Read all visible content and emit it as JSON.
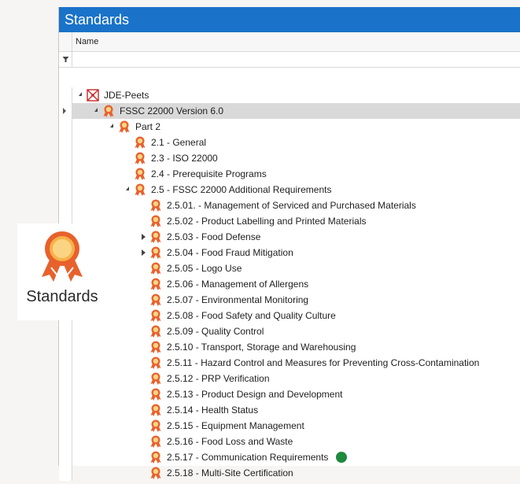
{
  "panel": {
    "title": "Standards",
    "column_name": "Name"
  },
  "tree": [
    {
      "label": "JDE-Peets",
      "depth": 0,
      "icon": "red-network-icon",
      "toggle": "expanded"
    },
    {
      "label": "FSSC 22000 Version 6.0",
      "depth": 1,
      "icon": "standard-ribbon-icon",
      "toggle": "expanded",
      "selected": true,
      "pointer": true
    },
    {
      "label": "Part 2",
      "depth": 2,
      "icon": "standard-ribbon-icon",
      "toggle": "expanded"
    },
    {
      "label": "2.1 - General",
      "depth": 3,
      "icon": "standard-ribbon-icon"
    },
    {
      "label": "2.3 - ISO 22000",
      "depth": 3,
      "icon": "standard-ribbon-icon"
    },
    {
      "label": "2.4 - Prerequisite Programs",
      "depth": 3,
      "icon": "standard-ribbon-icon"
    },
    {
      "label": "2.5 - FSSC 22000 Additional Requirements",
      "depth": 3,
      "icon": "standard-ribbon-icon",
      "toggle": "expanded"
    },
    {
      "label": "2.5.01. - Management of Serviced and Purchased Materials",
      "depth": 4,
      "icon": "standard-ribbon-icon"
    },
    {
      "label": "2.5.02 - Product Labelling and Printed Materials",
      "depth": 4,
      "icon": "standard-ribbon-icon"
    },
    {
      "label": "2.5.03 - Food Defense",
      "depth": 4,
      "icon": "standard-ribbon-icon",
      "toggle": "collapsed"
    },
    {
      "label": "2.5.04 - Food Fraud Mitigation",
      "depth": 4,
      "icon": "standard-ribbon-icon",
      "toggle": "collapsed"
    },
    {
      "label": "2.5.05 - Logo Use",
      "depth": 4,
      "icon": "standard-ribbon-icon"
    },
    {
      "label": "2.5.06 - Management of Allergens",
      "depth": 4,
      "icon": "standard-ribbon-icon"
    },
    {
      "label": "2.5.07 - Environmental Monitoring",
      "depth": 4,
      "icon": "standard-ribbon-icon"
    },
    {
      "label": "2.5.08 - Food Safety and Quality Culture",
      "depth": 4,
      "icon": "standard-ribbon-icon"
    },
    {
      "label": "2.5.09 - Quality Control",
      "depth": 4,
      "icon": "standard-ribbon-icon"
    },
    {
      "label": "2.5.10 - Transport, Storage and Warehousing",
      "depth": 4,
      "icon": "standard-ribbon-icon"
    },
    {
      "label": "2.5.11 - Hazard Control and Measures for Preventing Cross-Contamination",
      "depth": 4,
      "icon": "standard-ribbon-icon"
    },
    {
      "label": "2.5.12 - PRP Verification",
      "depth": 4,
      "icon": "standard-ribbon-icon"
    },
    {
      "label": "2.5.13 - Product Design and Development",
      "depth": 4,
      "icon": "standard-ribbon-icon"
    },
    {
      "label": "2.5.14 - Health Status",
      "depth": 4,
      "icon": "standard-ribbon-icon"
    },
    {
      "label": "2.5.15 - Equipment Management",
      "depth": 4,
      "icon": "standard-ribbon-icon"
    },
    {
      "label": "2.5.16 - Food Loss and Waste",
      "depth": 4,
      "icon": "standard-ribbon-icon"
    },
    {
      "label": "2.5.17 - Communication Requirements",
      "depth": 4,
      "icon": "standard-ribbon-icon",
      "status_dot": "#1e8a3d"
    },
    {
      "label": "2.5.18 - Multi-Site Certification",
      "depth": 4,
      "icon": "standard-ribbon-icon"
    }
  ],
  "overlay": {
    "caption": "Standards",
    "icon": "standards-ribbon-icon"
  },
  "colors": {
    "title_bar": "#1a73c8",
    "ribbon_orange": "#e8612c",
    "network_red": "#c62828",
    "status_green": "#1e8a3d"
  }
}
